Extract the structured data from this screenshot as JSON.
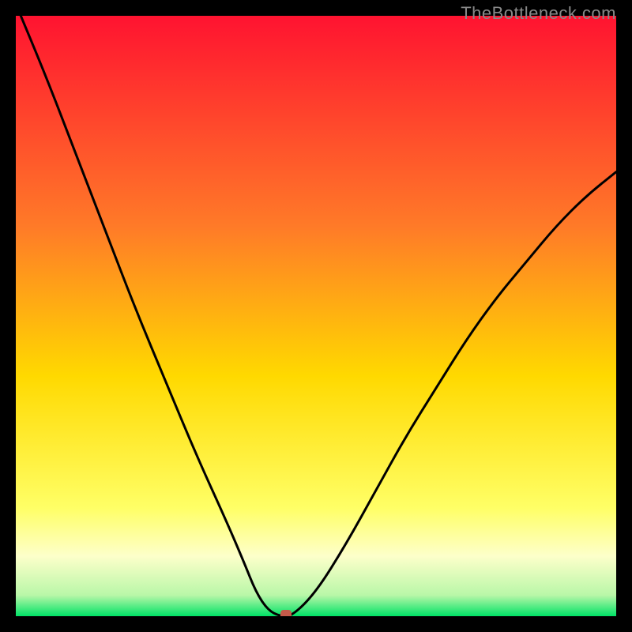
{
  "watermark": "TheBottleneck.com",
  "chart_data": {
    "type": "line",
    "title": "",
    "xlabel": "",
    "ylabel": "",
    "xlim": [
      0,
      100
    ],
    "ylim": [
      0,
      100
    ],
    "series": [
      {
        "name": "curve",
        "x": [
          0,
          5,
          10,
          15,
          20,
          25,
          30,
          35,
          38,
          40,
          42,
          44,
          46,
          50,
          55,
          60,
          65,
          70,
          75,
          80,
          85,
          90,
          95,
          100
        ],
        "y": [
          102,
          90,
          77,
          64,
          51,
          39,
          27,
          16,
          9,
          4,
          1,
          0,
          0,
          4,
          12,
          21,
          30,
          38,
          46,
          53,
          59,
          65,
          70,
          74
        ]
      }
    ],
    "marker": {
      "x": 45,
      "y": 0
    },
    "background_gradient": {
      "stops": [
        {
          "offset": 0.0,
          "color": "#ff1330"
        },
        {
          "offset": 0.35,
          "color": "#ff7a28"
        },
        {
          "offset": 0.6,
          "color": "#ffd900"
        },
        {
          "offset": 0.82,
          "color": "#ffff66"
        },
        {
          "offset": 0.9,
          "color": "#fdffca"
        },
        {
          "offset": 0.965,
          "color": "#b9f7a8"
        },
        {
          "offset": 1.0,
          "color": "#00e266"
        }
      ]
    }
  }
}
